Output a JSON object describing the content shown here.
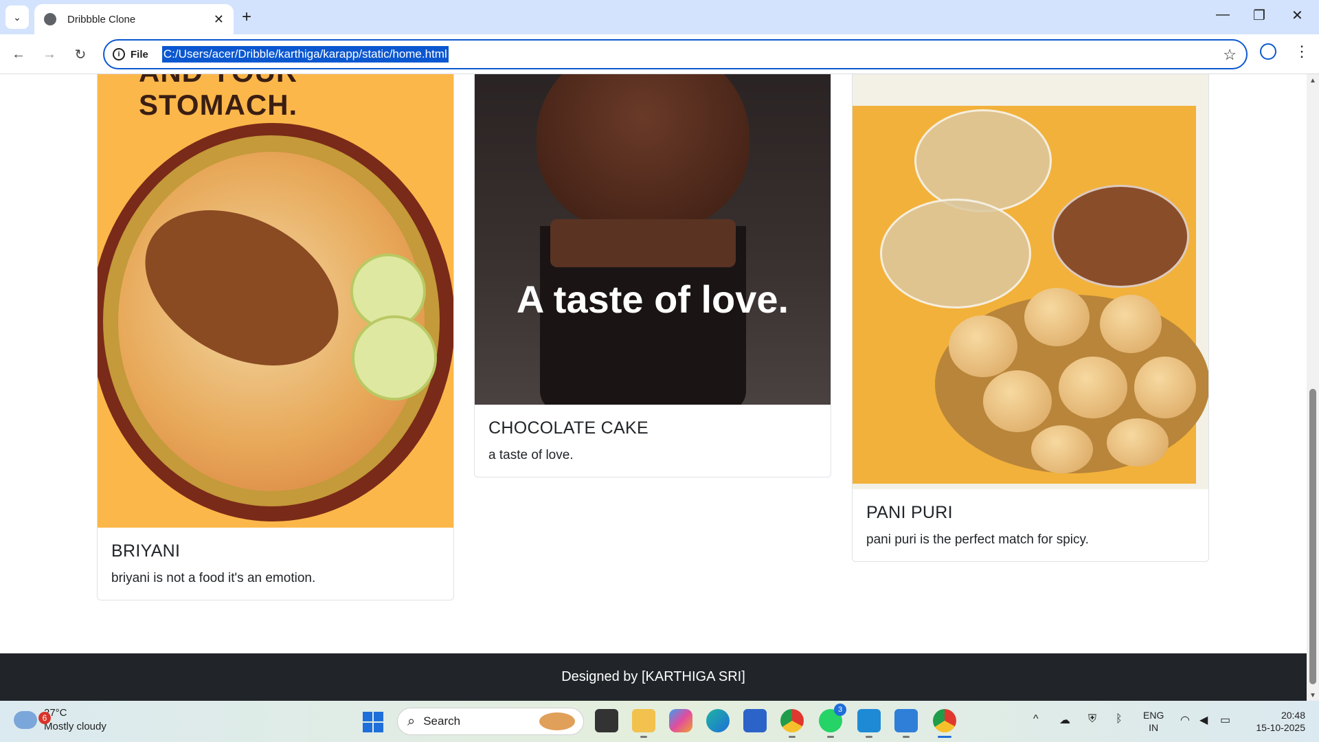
{
  "browser": {
    "tab_title": "Dribbble Clone",
    "site_info_label": "File",
    "url": "C:/Users/acer/Dribble/karthiga/karapp/static/home.html",
    "icons": [
      "tab-list-icon",
      "globe-icon",
      "close-icon",
      "plus-icon",
      "minimize-icon",
      "restore-icon",
      "window-close-icon",
      "back-icon",
      "forward-icon",
      "reload-icon",
      "info-icon",
      "star-icon",
      "profile-icon",
      "menu-icon"
    ]
  },
  "cards": [
    {
      "title": "BRIYANI",
      "text": "briyani is not a food it's an emotion.",
      "image_text": "AND YOUR STOMACH."
    },
    {
      "title": "CHOCOLATE CAKE",
      "text": "a taste of love.",
      "image_text": "A taste of love."
    },
    {
      "title": "PANI PURI",
      "text": "pani puri is the perfect match for spicy."
    }
  ],
  "footer": {
    "text": "Designed by [KARTHIGA SRI]"
  },
  "taskbar": {
    "weather_badge": "6",
    "temperature": "27°C",
    "weather": "Mostly cloudy",
    "search_label": "Search",
    "whatsapp_badge": "3",
    "lang_top": "ENG",
    "lang_bottom": "IN",
    "time": "20:48",
    "date": "15-10-2025"
  },
  "colors": {
    "accent": "#0b57d0",
    "footer_bg": "#212529",
    "tabstrip_bg": "#d3e3fd"
  }
}
